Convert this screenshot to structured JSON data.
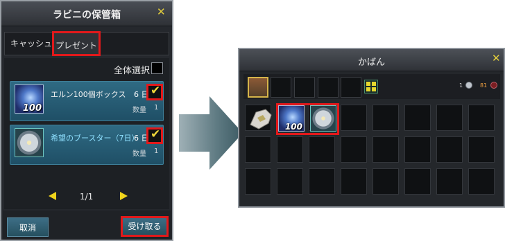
{
  "storage": {
    "title": "ラビニの保管箱",
    "close_icon": "close-x-icon",
    "tabs": [
      {
        "label": "キャッシュ"
      },
      {
        "label": "プレゼント",
        "selected": true
      }
    ],
    "select_all_label": "全体選択",
    "items": [
      {
        "name": "エルン100個ボックス",
        "days": "6 日",
        "quantity_label": "数量",
        "quantity": "1",
        "icon": "ern-box-icon",
        "icon_count": "100",
        "checked": true
      },
      {
        "name": "希望のブースター（7日）",
        "days": "6 日",
        "quantity_label": "数量",
        "quantity": "1",
        "icon": "booster-icon",
        "checked": true
      }
    ],
    "pager": {
      "label": "1/1"
    },
    "buttons": {
      "cancel": "取消",
      "receive": "受け取る"
    }
  },
  "bag": {
    "title": "かばん",
    "close_icon": "close-x-icon",
    "currency_1": "1",
    "currency_2": "81",
    "stored_icon_count": "100"
  },
  "colors": {
    "highlight": "#e2191b",
    "accent_yellow": "#f0d41c",
    "card_blue": "#2f6a83"
  }
}
